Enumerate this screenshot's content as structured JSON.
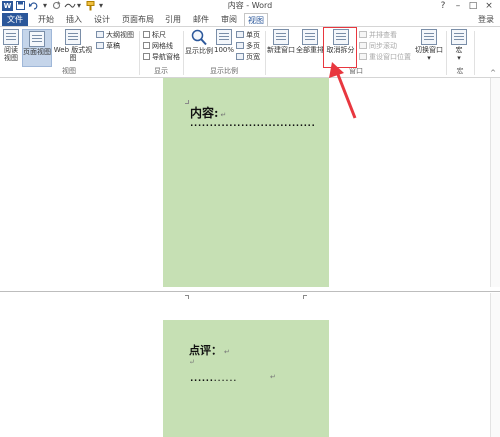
{
  "window": {
    "title": "内容 - Word",
    "logo_letter": "W",
    "help": "?",
    "minimize": "–",
    "restore": "□",
    "close": "×"
  },
  "quick_access": {
    "save_icon": "save-icon",
    "undo_icon": "undo-icon",
    "redo_icon": "redo-icon",
    "touch_icon": "touch-mode-icon",
    "painter_icon": "format-painter-icon",
    "customize_icon": "customize-icon"
  },
  "tabs": [
    "文件",
    "开始",
    "插入",
    "设计",
    "页面布局",
    "引用",
    "邮件",
    "审阅",
    "视图"
  ],
  "active_tab": "视图",
  "signin": "登录",
  "ribbon": {
    "views": {
      "read_mode": [
        "阅读",
        "视图"
      ],
      "print_layout": "页面视图",
      "web_layout": "Web 版式视图",
      "outline": "大纲视图",
      "draft": "草稿",
      "label": "视图"
    },
    "show": {
      "ruler": "标尺",
      "gridlines": "网格线",
      "nav_pane": "导航窗格",
      "label": "显示"
    },
    "zoom": {
      "zoom": "显示比例",
      "hundred": "100%",
      "one_page": "单页",
      "multiple": "多页",
      "page_width": "页宽",
      "label": "显示比例"
    },
    "window": {
      "new_window": "新建窗口",
      "arrange_all": "全部重排",
      "remove_split": "取消拆分",
      "side_by_side": "并排查看",
      "sync_scroll": "同步滚动",
      "reset_pos": "重设窗口位置",
      "switch_windows": "切换窗口",
      "label": "窗口"
    },
    "macros": {
      "macros": "宏",
      "label": "宏"
    },
    "collapse": "^"
  },
  "document": {
    "top_heading": "内容:",
    "top_dots": "................................",
    "bottom_heading": "点评：",
    "bottom_dots": "......",
    "bottom_dots2": "......",
    "para_mark": "↵"
  }
}
